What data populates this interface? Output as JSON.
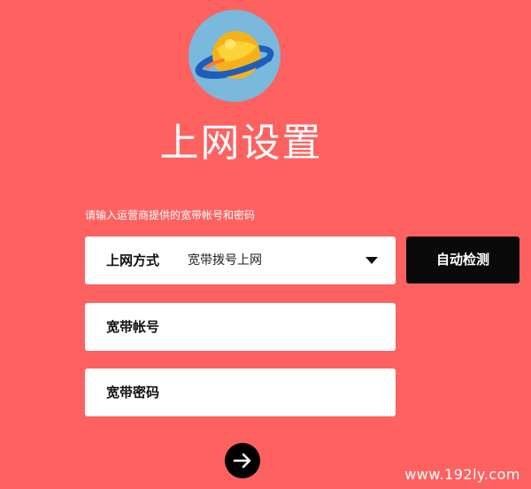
{
  "title": "上网设置",
  "hint": "请输入运营商提供的宽带帐号和密码",
  "connection": {
    "label": "上网方式",
    "value": "宽带拨号上网"
  },
  "detect_button": "自动检测",
  "account": {
    "label": "宽带帐号",
    "value": ""
  },
  "password": {
    "label": "宽带密码",
    "value": ""
  },
  "icons": {
    "logo": "planet-icon",
    "dropdown": "caret-down-icon",
    "next": "arrow-right-icon"
  },
  "colors": {
    "background": "#fd6261",
    "button": "#0a0a0a",
    "planet_circle": "#7ab8dc",
    "planet": "#f4b21a",
    "ring": "#1f5dbb"
  },
  "watermark": "www.192ly.com"
}
